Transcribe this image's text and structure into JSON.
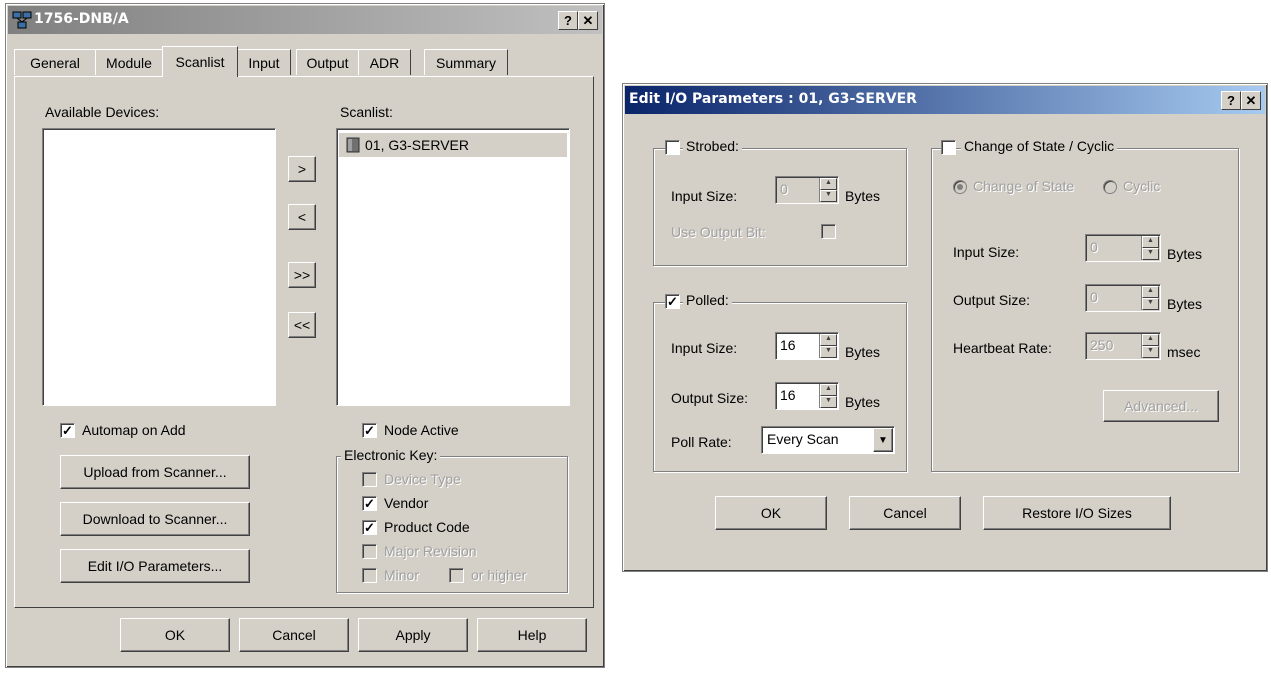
{
  "left_window": {
    "title": "1756-DNB/A",
    "tabs": [
      "General",
      "Module",
      "Scanlist",
      "Input",
      "Output",
      "ADR",
      "Summary"
    ],
    "active_tab": "Scanlist",
    "available_label": "Available Devices:",
    "scanlist_label": "Scanlist:",
    "scanlist_items": [
      "01, G3-SERVER"
    ],
    "move_buttons": [
      ">",
      "<",
      ">>",
      "<<"
    ],
    "automap_label": "Automap on Add",
    "automap_checked": true,
    "upload_button": "Upload from Scanner...",
    "download_button": "Download to Scanner...",
    "edit_io_button": "Edit I/O Parameters...",
    "node_active_label": "Node Active",
    "node_active_checked": true,
    "electronic_key_label": "Electronic Key:",
    "key_device_type": "Device Type",
    "key_vendor": "Vendor",
    "key_product_code": "Product Code",
    "key_major_revision": "Major Revision",
    "key_minor": "Minor",
    "key_or_higher": "or higher",
    "ok_button": "OK",
    "cancel_button": "Cancel",
    "apply_button": "Apply",
    "help_button": "Help"
  },
  "right_window": {
    "title": "Edit I/O Parameters : 01, G3-SERVER",
    "strobed_label": "Strobed:",
    "strobed_checked": false,
    "strobed_input_size_label": "Input Size:",
    "strobed_input_size_value": "0",
    "bytes_unit": "Bytes",
    "use_output_bit_label": "Use Output Bit:",
    "polled_label": "Polled:",
    "polled_checked": true,
    "polled_input_size_label": "Input Size:",
    "polled_input_size_value": "16",
    "polled_output_size_label": "Output Size:",
    "polled_output_size_value": "16",
    "poll_rate_label": "Poll Rate:",
    "poll_rate_value": "Every Scan",
    "cos_label": "Change of State / Cyclic",
    "cos_checked": false,
    "radio_change_of_state": "Change of State",
    "radio_cyclic": "Cyclic",
    "cos_input_size_label": "Input Size:",
    "cos_input_size_value": "0",
    "cos_output_size_label": "Output Size:",
    "cos_output_size_value": "0",
    "heartbeat_label": "Heartbeat Rate:",
    "heartbeat_value": "250",
    "msec_unit": "msec",
    "advanced_button": "Advanced...",
    "ok_button": "OK",
    "cancel_button": "Cancel",
    "restore_button": "Restore I/O Sizes"
  },
  "caption_help_glyph": "?",
  "caption_close_glyph": "✕",
  "check_glyph": "✓",
  "dropdown_arrow_glyph": "▼",
  "spin_up_glyph": "▲",
  "spin_down_glyph": "▼",
  "icons": {
    "app_icon": "network-module-icon",
    "device_icon": "device-icon"
  },
  "colors": {
    "dialog_face": "#d4d0c8",
    "active_title": "#0a246a",
    "inactive_title": "#808080"
  }
}
